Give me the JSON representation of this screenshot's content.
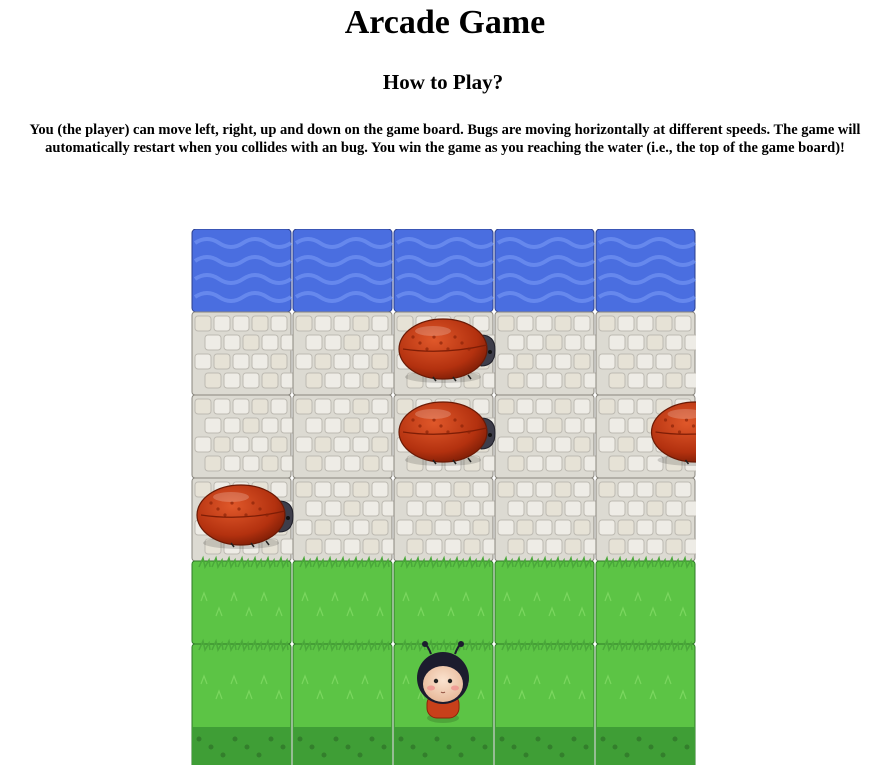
{
  "page": {
    "title": "Arcade Game",
    "subtitle": "How to Play?",
    "instructions": "You (the player) can move left, right, up and down on the game board. Bugs are moving horizontally at different speeds. The game will automatically restart when you collides with an bug. You win the game as you reaching the water (i.e., the top of the game board)!"
  },
  "board": {
    "columns": 5,
    "rows": [
      "water",
      "stone",
      "stone",
      "stone",
      "grass",
      "grass"
    ],
    "colors": {
      "water": "#4a6ee0",
      "water_light": "#6d8ef0",
      "stone": "#dcdad2",
      "stone_dark": "#bdbab2",
      "grass": "#5cc445",
      "grass_dark": "#3f9e36",
      "bug": "#c23b14",
      "bug_head": "#3d3d4a"
    },
    "enemies": [
      {
        "name": "enemy-bug-1",
        "row": 1,
        "col": 2
      },
      {
        "name": "enemy-bug-2",
        "row": 2,
        "col": 2
      },
      {
        "name": "enemy-bug-3",
        "row": 2,
        "col": 4.5
      },
      {
        "name": "enemy-bug-4",
        "row": 3,
        "col": 0
      }
    ],
    "player": {
      "name": "player-character",
      "row": 5,
      "col": 2
    }
  }
}
